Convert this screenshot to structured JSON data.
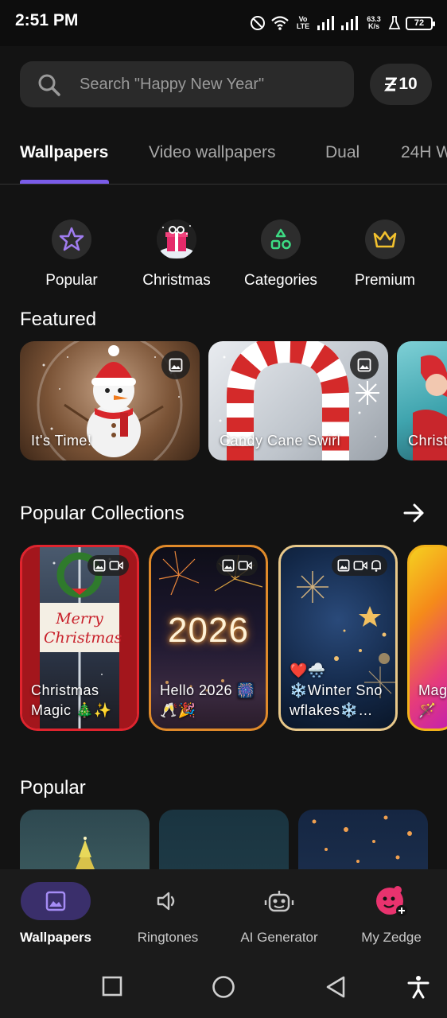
{
  "status": {
    "time": "2:51 PM",
    "network": "Vo LTE",
    "speed_value": "63.3",
    "speed_unit": "K/s",
    "battery": "72"
  },
  "search": {
    "placeholder": "Search \"Happy New Year\"",
    "coins": "10"
  },
  "tabs": [
    {
      "label": "Wallpapers",
      "active": true
    },
    {
      "label": "Video wallpapers"
    },
    {
      "label": "Dual"
    },
    {
      "label": "24H W"
    }
  ],
  "quick": [
    {
      "label": "Popular",
      "icon": "star-icon"
    },
    {
      "label": "Christmas",
      "icon": "gift-icon"
    },
    {
      "label": "Categories",
      "icon": "shapes-icon"
    },
    {
      "label": "Premium",
      "icon": "crown-icon"
    }
  ],
  "featured": {
    "title": "Featured",
    "items": [
      {
        "label": "It's Time!"
      },
      {
        "label": "Candy Cane Swirl"
      },
      {
        "label": "Christ"
      }
    ]
  },
  "collections": {
    "title": "Popular Collections",
    "items": [
      {
        "label": "Christmas Magic 🎄✨",
        "sign": "Merry Christmas",
        "border": "#e0242e"
      },
      {
        "label": "Hello 2026 🎆🥂🎉",
        "year": "2026",
        "border": "#e08a2a"
      },
      {
        "label": "❤️🌨️ ❄️Winter Sno wflakes❄️…",
        "border": "#e8c88a"
      },
      {
        "label": "Mag 🪄",
        "border": "#f2b21a"
      }
    ]
  },
  "popular": {
    "title": "Popular"
  },
  "nav": [
    {
      "label": "Wallpapers",
      "active": true
    },
    {
      "label": "Ringtones"
    },
    {
      "label": "AI Generator"
    },
    {
      "label": "My Zedge"
    }
  ],
  "colors": {
    "accent": "#7a5ce8",
    "background": "#131313"
  }
}
